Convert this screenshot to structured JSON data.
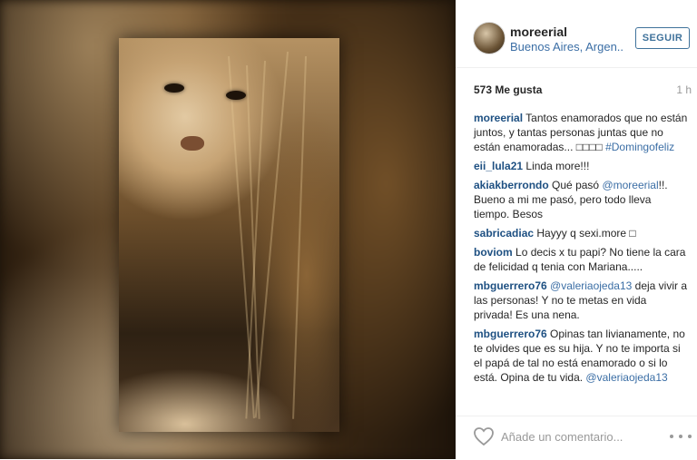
{
  "post": {
    "username": "moreerial",
    "location": "Buenos Aires, Argen...",
    "follow_label": "SEGUIR",
    "likes": "573 Me gusta",
    "time": "1 h"
  },
  "comments": [
    {
      "user": "moreerial",
      "text": "Tantos enamorados que no están juntos, y tantas personas juntas que no están enamoradas... □□□□",
      "tag": "#Domingofeliz"
    },
    {
      "user": "eii_lula21",
      "text": "Linda more!!!"
    },
    {
      "user": "akiakberrondo",
      "text": "Qué pasó",
      "mention": "@moreerial",
      "text2": "!!. Bueno a mi me pasó, pero todo lleva tiempo. Besos"
    },
    {
      "user": "sabricadiac",
      "text": "Hayyy q sexi.more □"
    },
    {
      "user": "boviom",
      "text": "Lo decis x tu papi? No tiene la cara de felicidad q tenia con Mariana....."
    },
    {
      "user": "mbguerrero76",
      "mention": "@valeriaojeda13",
      "text2": "deja vivir a las personas! Y no te metas en vida privada! Es una nena."
    },
    {
      "user": "mbguerrero76",
      "text": "Opinas tan livianamente, no te olvides que es su hija. Y no te importa si el papá de tal no está enamorado o si lo está. Opina de tu vida.",
      "mention": "@valeriaojeda13"
    }
  ],
  "footer": {
    "comment_placeholder": "Añade un comentario...",
    "like_icon": "heart-icon",
    "more_icon": "more-options-icon"
  },
  "colors": {
    "link": "#3b6ea5",
    "username": "#1e5082",
    "follow_border": "#3f729b"
  }
}
